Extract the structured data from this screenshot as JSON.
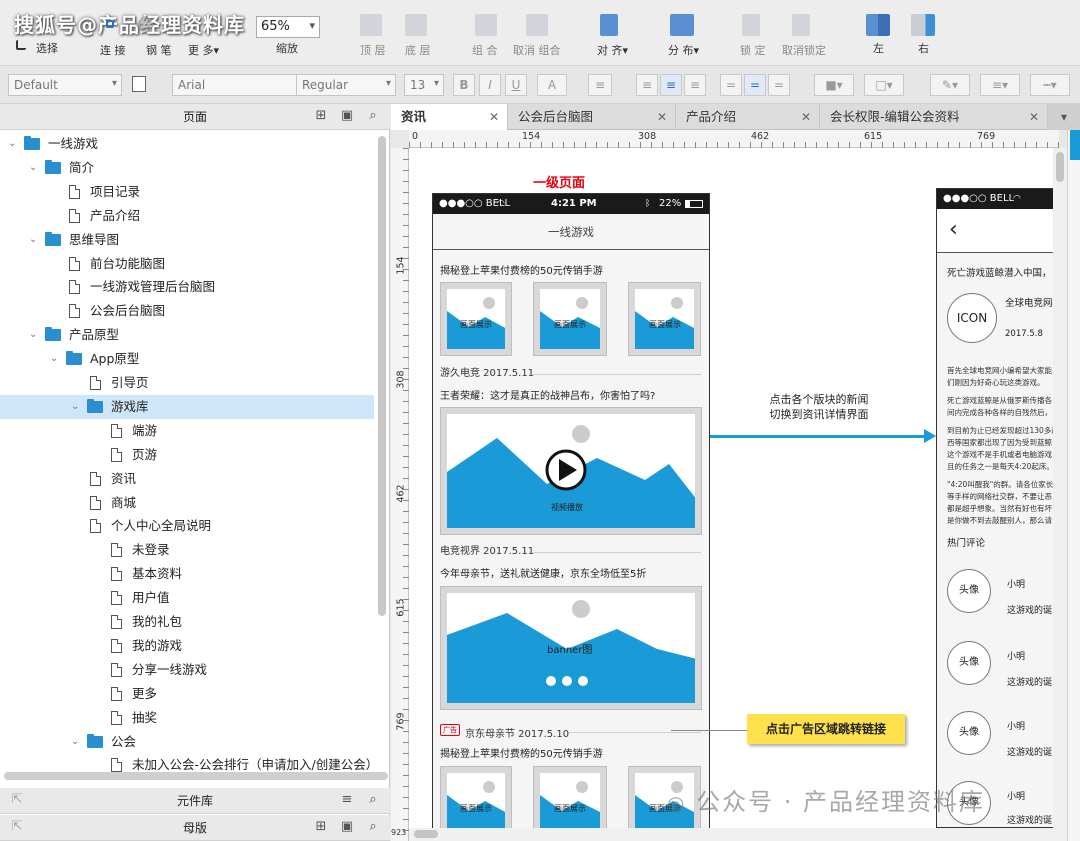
{
  "watermark_top": "搜狐号@产品经理资料库",
  "watermark_bottom": "公众号 · 产品经理资料库",
  "toolbar": {
    "select": "选择",
    "connect": "连 接",
    "pen": "钢 笔",
    "more": "更 多▾",
    "zoom_value": "65%",
    "zoom_label": "缩放",
    "top": "顶 层",
    "bottom": "底 层",
    "group": "组 合",
    "ungroup": "取消 组合",
    "align": "对 齐▾",
    "distribute": "分 布▾",
    "lock": "锁 定",
    "unlock": "取消锁定",
    "left": "左",
    "right": "右"
  },
  "format_bar": {
    "style": "Default",
    "font": "Arial",
    "weight": "Regular",
    "size": "13"
  },
  "left_panel": {
    "pages_header": "页面",
    "widgets_header": "元件库",
    "masters_header": "母版",
    "tree": [
      {
        "label": "一线游戏",
        "type": "folder",
        "level": 0
      },
      {
        "label": "简介",
        "type": "folder",
        "level": 1
      },
      {
        "label": "项目记录",
        "type": "page",
        "level": 2
      },
      {
        "label": "产品介绍",
        "type": "page",
        "level": 2
      },
      {
        "label": "思维导图",
        "type": "folder",
        "level": 1
      },
      {
        "label": "前台功能脑图",
        "type": "page",
        "level": 2
      },
      {
        "label": "一线游戏管理后台脑图",
        "type": "page",
        "level": 2
      },
      {
        "label": "公会后台脑图",
        "type": "page",
        "level": 2
      },
      {
        "label": "产品原型",
        "type": "folder",
        "level": 1
      },
      {
        "label": "App原型",
        "type": "folder",
        "level": 2
      },
      {
        "label": "引导页",
        "type": "page",
        "level": 3
      },
      {
        "label": "游戏库",
        "type": "folder",
        "level": 3,
        "selected": true
      },
      {
        "label": "端游",
        "type": "page",
        "level": 4
      },
      {
        "label": "页游",
        "type": "page",
        "level": 4
      },
      {
        "label": "资讯",
        "type": "page",
        "level": 3
      },
      {
        "label": "商城",
        "type": "page",
        "level": 3
      },
      {
        "label": "个人中心全局说明",
        "type": "page",
        "level": 3
      },
      {
        "label": "未登录",
        "type": "page",
        "level": 4
      },
      {
        "label": "基本资料",
        "type": "page",
        "level": 4
      },
      {
        "label": "用户值",
        "type": "page",
        "level": 4
      },
      {
        "label": "我的礼包",
        "type": "page",
        "level": 4
      },
      {
        "label": "我的游戏",
        "type": "page",
        "level": 4
      },
      {
        "label": "分享一线游戏",
        "type": "page",
        "level": 4
      },
      {
        "label": "更多",
        "type": "page",
        "level": 4
      },
      {
        "label": "抽奖",
        "type": "page",
        "level": 4
      },
      {
        "label": "公会",
        "type": "folder",
        "level": 3
      },
      {
        "label": "未加入公会-公会排行（申请加入/创建公会）",
        "type": "page",
        "level": 4
      }
    ]
  },
  "tabs": [
    {
      "label": "资讯",
      "active": true
    },
    {
      "label": "公会后台脑图",
      "active": false
    },
    {
      "label": "产品介绍",
      "active": false
    },
    {
      "label": "会长权限-编辑公会资料",
      "active": false
    }
  ],
  "ruler": {
    "top": [
      "0",
      "154",
      "308",
      "462",
      "615",
      "769"
    ],
    "left": [
      "154",
      "308",
      "462",
      "615",
      "769",
      "923"
    ]
  },
  "canvas": {
    "level_title": "一级页面",
    "status_carrier": "●●●○○ BELL",
    "status_time": "4:21 PM",
    "status_battery": "22%",
    "nav_title": "一线游戏",
    "news1_title": "揭秘登上苹果付费榜的50元传销手游",
    "thumb_label": "画面展示",
    "news1_meta": "游久电竞   2017.5.11",
    "news2_title": "王者荣耀：这才是真正的战神吕布，你害怕了吗?",
    "video_label": "视频播放",
    "news2_meta": "电竞视界   2017.5.11",
    "news3_title": "今年母亲节，送礼就送健康，京东全场低至5折",
    "banner_label": "banner图",
    "ad_badge": "广告",
    "ad_meta": "京东母亲节    2017.5.10",
    "news4_title": "揭秘登上苹果付费榜的50元传销手游",
    "arrow_note_line1": "点击各个版块的新闻",
    "arrow_note_line2": "切换到资讯详情界面",
    "ad_note": "点击广告区域跳转链接",
    "detail": {
      "status_carrier": "●●●○○ BELL",
      "headline": "死亡游戏蓝鲸潜入中国，",
      "icon_label": "ICON",
      "source": "全球电竞网",
      "date": "2017.5.8",
      "para1a": "首先全球电竞网小编希望大家能",
      "para1b": "们刚因为好奇心玩这类游戏。",
      "para2a": "死亡游戏蓝鲸是从俄罗斯传播各",
      "para2b": "间内完成各种各样的自残然后，",
      "para3a": "到目前为止已经发现超过130多起",
      "para3b": "西等国家都出现了因为受到蓝鲸",
      "para3c": "这个游戏不是手机或者电脑游戏",
      "para3d": "且的任务之一是每天4:20起床。",
      "para4a": "\"4:20叫醒我\"的群。请各位家长",
      "para4b": "等手样的网络社交群，不要让恶",
      "para4c": "都是超乎想象。当然有好也有坏",
      "para4d": "是你做不到去敲醒别人，那么请",
      "comments_title": "热门评论",
      "avatar_label": "头像",
      "commenter": "小明",
      "comment_text": "这游戏的诞"
    }
  },
  "colors": {
    "accent_blue": "#1a9ad6",
    "title_red": "#e60012",
    "note_yellow": "#ffe14d"
  }
}
